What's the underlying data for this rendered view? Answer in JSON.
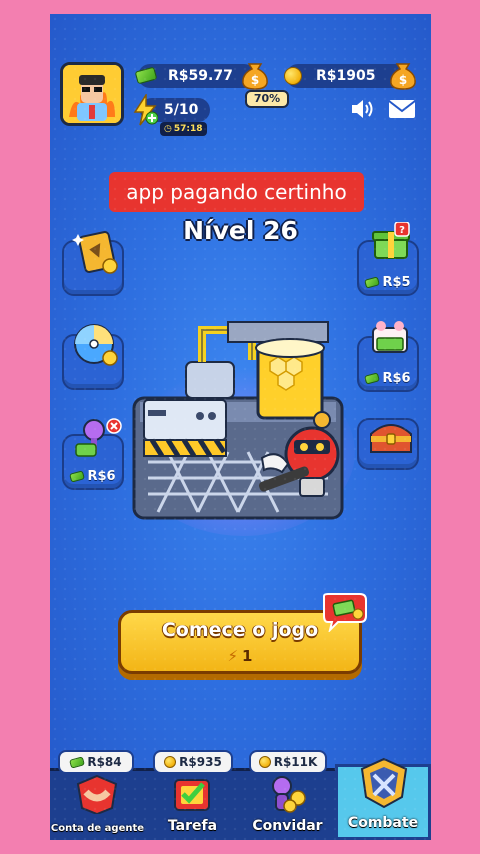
{
  "header": {
    "cash_balance": "R$59.77",
    "coin_balance": "R$1905",
    "progress_badge": "70%",
    "energy": "5/10",
    "energy_timer": "57:18"
  },
  "banner": {
    "text": "app pagando certinho"
  },
  "level": {
    "label": "Nível 26"
  },
  "left_buttons": [
    {
      "icon": "ticket-card-icon",
      "label": ""
    },
    {
      "icon": "lucky-wheel-icon",
      "label": ""
    },
    {
      "icon": "claw-machine-icon",
      "label": "R$6"
    }
  ],
  "right_buttons": [
    {
      "icon": "gift-box-icon",
      "label": "R$5"
    },
    {
      "icon": "cash-pile-icon",
      "label": "R$6"
    },
    {
      "icon": "treasure-chest-icon",
      "label": ""
    }
  ],
  "start_button": {
    "label": "Comece o jogo",
    "cost": "1"
  },
  "bottom_nav": [
    {
      "label": "Conta de agente",
      "chip": "R$84",
      "chip_icon": "cash-icon"
    },
    {
      "label": "Tarefa",
      "chip": "R$935",
      "chip_icon": "coin-icon"
    },
    {
      "label": "Convidar",
      "chip": "R$11K",
      "chip_icon": "coin-icon"
    },
    {
      "label": "Combate",
      "chip": "",
      "chip_icon": ""
    }
  ],
  "colors": {
    "page_bg": "#f37fb0",
    "game_bg": "#2e6fe0",
    "banner_red": "#e8342f",
    "start_button_yellow": "#f9c520",
    "nav_active": "#56c8ec"
  }
}
